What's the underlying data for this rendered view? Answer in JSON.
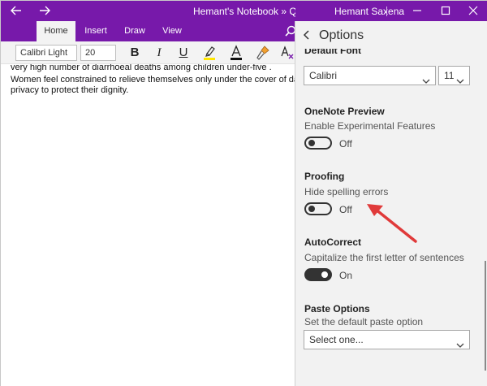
{
  "titlebar": {
    "doc_title": "Hemant's Notebook » Quic...",
    "user_name": "Hemant Saxena",
    "back_icon": "arrow-left-icon",
    "forward_icon": "arrow-right-icon",
    "accent": "#7719aa"
  },
  "ribbon": {
    "tabs": [
      {
        "label": "Home",
        "active": true
      },
      {
        "label": "Insert"
      },
      {
        "label": "Draw"
      },
      {
        "label": "View"
      }
    ],
    "font_name": "Calibri Light",
    "font_size": "20",
    "bold_label": "B",
    "italic_label": "I",
    "underline_label": "U"
  },
  "document": {
    "lines": [
      "very high number of diarrhoeal deaths among children under-five .",
      "Women feel constrained to relieve themselves only under the cover of darkne",
      "privacy to protect their dignity."
    ]
  },
  "options": {
    "title": "Options",
    "default_font_label": "Default Font",
    "font_select": "Calibri",
    "size_select": "11",
    "preview": {
      "heading": "OneNote Preview",
      "description": "Enable Experimental Features",
      "state": "Off"
    },
    "proofing": {
      "heading": "Proofing",
      "description": "Hide spelling errors",
      "state": "Off"
    },
    "autocorrect": {
      "heading": "AutoCorrect",
      "description": "Capitalize the first letter of sentences",
      "state": "On"
    },
    "paste": {
      "heading": "Paste Options",
      "description": "Set the default paste option",
      "placeholder": "Select one..."
    }
  },
  "annotation": {
    "arrow_color": "#e03a3a"
  }
}
